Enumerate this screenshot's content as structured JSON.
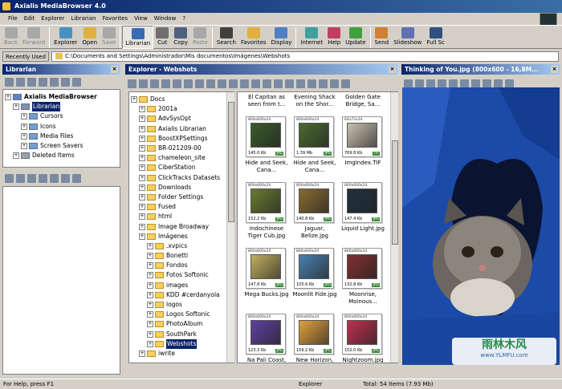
{
  "window": {
    "title": "Axialis MediaBrowser 4.0"
  },
  "menu": [
    "File",
    "Edit",
    "Explorer",
    "Librarian",
    "Favorites",
    "View",
    "Window",
    "?"
  ],
  "toolbar": [
    {
      "label": "Back",
      "icon": "back-arrow-icon",
      "enabled": false
    },
    {
      "label": "Forward",
      "icon": "forward-arrow-icon",
      "enabled": false
    },
    {
      "label": "Explorer",
      "icon": "explorer-icon",
      "enabled": true
    },
    {
      "label": "Open",
      "icon": "open-folder-icon",
      "enabled": true
    },
    {
      "label": "Save",
      "icon": "save-icon",
      "enabled": false
    },
    {
      "label": "Librarian",
      "icon": "librarian-icon",
      "enabled": true,
      "active": true
    },
    {
      "label": "Cut",
      "icon": "scissors-icon",
      "enabled": true
    },
    {
      "label": "Copy",
      "icon": "copy-icon",
      "enabled": true
    },
    {
      "label": "Paste",
      "icon": "paste-icon",
      "enabled": false
    },
    {
      "label": "Search",
      "icon": "binoculars-icon",
      "enabled": true
    },
    {
      "label": "Favorites",
      "icon": "favorites-folder-icon",
      "enabled": true
    },
    {
      "label": "Display",
      "icon": "display-icon",
      "enabled": true
    },
    {
      "label": "Internet",
      "icon": "globe-icon",
      "enabled": true
    },
    {
      "label": "Help",
      "icon": "help-icon",
      "enabled": true
    },
    {
      "label": "Update",
      "icon": "update-icon",
      "enabled": true
    },
    {
      "label": "Send",
      "icon": "send-icon",
      "enabled": true
    },
    {
      "label": "Slideshow",
      "icon": "slideshow-icon",
      "enabled": true
    },
    {
      "label": "Full Sc",
      "icon": "fullscreen-icon",
      "enabled": true
    }
  ],
  "address": {
    "label": "Recently Used",
    "path": "C:\\Documents and Settings\\Administrador\\Mis documentos\\Imágenes\\Webshots"
  },
  "librarian": {
    "title": "Librarian",
    "tree": [
      {
        "label": "Axialis MediaBrowser",
        "level": 0,
        "bold": true
      },
      {
        "label": "Librarian",
        "level": 1,
        "selected": true
      },
      {
        "label": "Cursors",
        "level": 2
      },
      {
        "label": "Icons",
        "level": 2
      },
      {
        "label": "Media Files",
        "level": 2
      },
      {
        "label": "Screen Savers",
        "level": 2
      },
      {
        "label": "Deleted Items",
        "level": 1
      }
    ]
  },
  "explorer": {
    "title": "Explorer - Webshots",
    "tree": [
      {
        "label": "Docs",
        "level": 0
      },
      {
        "label": "2001a",
        "level": 1
      },
      {
        "label": "AdvSysOpt",
        "level": 1
      },
      {
        "label": "Axialis Librarian",
        "level": 1
      },
      {
        "label": "BoostXPSettings",
        "level": 1
      },
      {
        "label": "BR-021209-00",
        "level": 1
      },
      {
        "label": "chameleon_site",
        "level": 1
      },
      {
        "label": "CiberStation",
        "level": 1
      },
      {
        "label": "ClickTracks Datasets",
        "level": 1
      },
      {
        "label": "Downloads",
        "level": 1
      },
      {
        "label": "Folder Settings",
        "level": 1
      },
      {
        "label": "Fused",
        "level": 1
      },
      {
        "label": "html",
        "level": 1
      },
      {
        "label": "Image Broadway",
        "level": 1
      },
      {
        "label": "Imágenes",
        "level": 1
      },
      {
        "label": ".xvpics",
        "level": 2
      },
      {
        "label": "Bonetti",
        "level": 2
      },
      {
        "label": "Fondos",
        "level": 2
      },
      {
        "label": "Fotos Softonic",
        "level": 2
      },
      {
        "label": "images",
        "level": 2
      },
      {
        "label": "KDD #cerdanyola",
        "level": 2
      },
      {
        "label": "logos",
        "level": 2
      },
      {
        "label": "Logos Softonic",
        "level": 2
      },
      {
        "label": "PhotoAlbum",
        "level": 2
      },
      {
        "label": "SouthPark",
        "level": 2
      },
      {
        "label": "Webshots",
        "level": 2,
        "selected": true
      },
      {
        "label": "iwrite",
        "level": 1
      }
    ],
    "top_captions": [
      "El Capitan as seen from t...",
      "Evening Shack on the Shor...",
      "Golden Gate Bridge, Sa..."
    ],
    "thumbnails": [
      {
        "dims": "800x600x24",
        "size": "145.0 Kb",
        "fmt": "JPG",
        "caption": "Hide and Seek, Cana...",
        "color": "#3a5a2a"
      },
      {
        "dims": "800x600x24",
        "size": "1.39 Mb",
        "fmt": "JPG",
        "caption": "Hide and Seek, Cana...",
        "color": "#4a6a30"
      },
      {
        "dims": "64x72x24",
        "size": "769.8 Kb",
        "fmt": "TIF",
        "caption": "ImgIndex.TIF",
        "color": "#c8c0b0"
      },
      {
        "dims": "800x600x24",
        "size": "152.2 Kb",
        "fmt": "JPG",
        "caption": "Indochinese Tiger Cub.jpg",
        "color": "#6a7a30"
      },
      {
        "dims": "800x600x24",
        "size": "140.8 Kb",
        "fmt": "JPG",
        "caption": "Jaguar, Belize.jpg",
        "color": "#8a6a30"
      },
      {
        "dims": "800x600x24",
        "size": "147.4 Kb",
        "fmt": "JPG",
        "caption": "Liquid Light.jpg",
        "color": "#203040"
      },
      {
        "dims": "800x600x24",
        "size": "147.8 Kb",
        "fmt": "JPG",
        "caption": "Mega Bucks.jpg",
        "color": "#c0b060"
      },
      {
        "dims": "800x600x24",
        "size": "105.6 Kb",
        "fmt": "JPG",
        "caption": "Moonlit Fide.jpg",
        "color": "#4a80b0"
      },
      {
        "dims": "800x600x24",
        "size": "132.8 Kb",
        "fmt": "JPG",
        "caption": "Moonrise, Moinous...",
        "color": "#803030"
      },
      {
        "dims": "800x600x24",
        "size": "123.3 Kb",
        "fmt": "JPG",
        "caption": "Na Pali Coast, Kauai, Haw...",
        "color": "#6040a0"
      },
      {
        "dims": "800x600x24",
        "size": "159.2 Kb",
        "fmt": "JPG",
        "caption": "New Horizon, Maui, Haw...",
        "color": "#e0a040"
      },
      {
        "dims": "800x600x24",
        "size": "152.0 Kb",
        "fmt": "JPG",
        "caption": "Nightzoom.jpg",
        "color": "#c03050"
      }
    ]
  },
  "viewer": {
    "title": "Thinking of You.jpg (800x600 - 16,8M..."
  },
  "status": {
    "help": "For Help, press F1",
    "mode": "Explorer",
    "total": "Total: 54 Items (7.93 Mb)"
  },
  "watermark": {
    "brand": "雨林木风",
    "url": "www.YLMFU.com"
  }
}
